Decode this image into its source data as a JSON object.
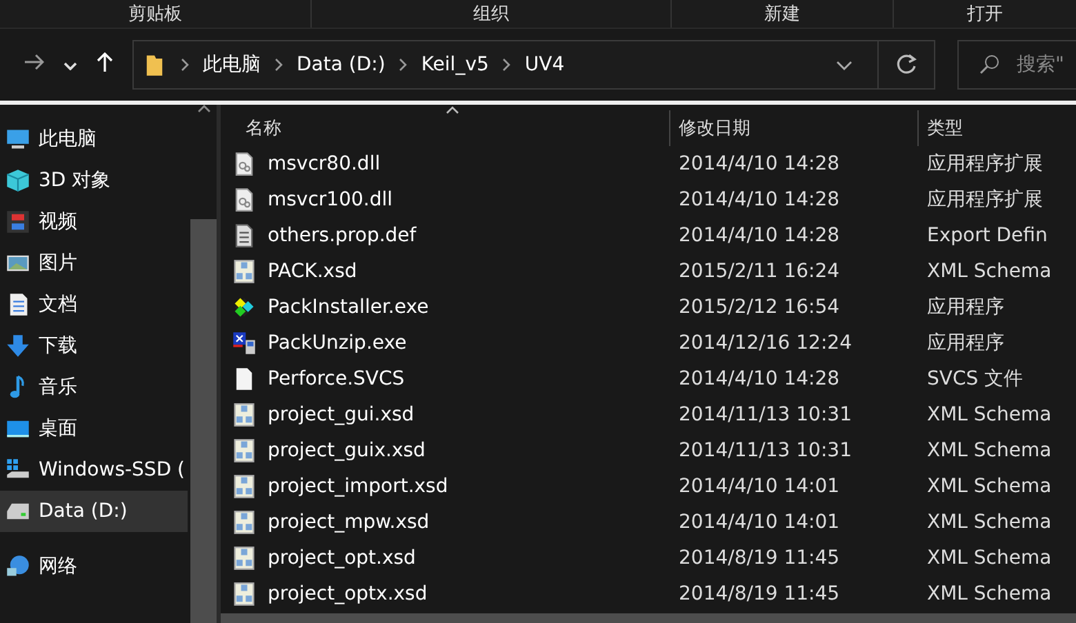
{
  "ribbon_groups": [
    "剪贴板",
    "组织",
    "新建",
    "打开"
  ],
  "address_bar": {
    "path": [
      "此电脑",
      "Data (D:)",
      "Keil_v5",
      "UV4"
    ]
  },
  "search": {
    "placeholder": "搜索\""
  },
  "sidebar": {
    "items": [
      {
        "label": "此电脑",
        "kind": "pc",
        "selected": false
      },
      {
        "label": "3D 对象",
        "kind": "cube",
        "selected": false
      },
      {
        "label": "视频",
        "kind": "video",
        "selected": false
      },
      {
        "label": "图片",
        "kind": "picture",
        "selected": false
      },
      {
        "label": "文档",
        "kind": "document",
        "selected": false
      },
      {
        "label": "下载",
        "kind": "download",
        "selected": false
      },
      {
        "label": "音乐",
        "kind": "music",
        "selected": false
      },
      {
        "label": "桌面",
        "kind": "desktop",
        "selected": false
      },
      {
        "label": "Windows-SSD (",
        "kind": "drive-windows",
        "selected": false
      },
      {
        "label": "Data (D:)",
        "kind": "drive",
        "selected": true
      },
      {
        "label": "网络",
        "kind": "network",
        "selected": false
      }
    ]
  },
  "table": {
    "columns": [
      {
        "label": "名称",
        "sorted": true
      },
      {
        "label": "修改日期",
        "sorted": false
      },
      {
        "label": "类型",
        "sorted": false
      }
    ],
    "rows": [
      {
        "name": "msvcr80.dll",
        "date": "2014/4/10 14:28",
        "type": "应用程序扩展",
        "kind": "dll"
      },
      {
        "name": "msvcr100.dll",
        "date": "2014/4/10 14:28",
        "type": "应用程序扩展",
        "kind": "dll"
      },
      {
        "name": "others.prop.def",
        "date": "2014/4/10 14:28",
        "type": "Export Defin",
        "kind": "text"
      },
      {
        "name": "PACK.xsd",
        "date": "2015/2/11 16:24",
        "type": "XML Schema",
        "kind": "xsd"
      },
      {
        "name": "PackInstaller.exe",
        "date": "2015/2/12 16:54",
        "type": "应用程序",
        "kind": "installer"
      },
      {
        "name": "PackUnzip.exe",
        "date": "2014/12/16 12:24",
        "type": "应用程序",
        "kind": "unzip"
      },
      {
        "name": "Perforce.SVCS",
        "date": "2014/4/10 14:28",
        "type": "SVCS 文件",
        "kind": "blank"
      },
      {
        "name": "project_gui.xsd",
        "date": "2014/11/13 10:31",
        "type": "XML Schema",
        "kind": "xsd"
      },
      {
        "name": "project_guix.xsd",
        "date": "2014/11/13 10:31",
        "type": "XML Schema",
        "kind": "xsd"
      },
      {
        "name": "project_import.xsd",
        "date": "2014/4/10 14:01",
        "type": "XML Schema",
        "kind": "xsd"
      },
      {
        "name": "project_mpw.xsd",
        "date": "2014/4/10 14:01",
        "type": "XML Schema",
        "kind": "xsd"
      },
      {
        "name": "project_opt.xsd",
        "date": "2014/8/19 11:45",
        "type": "XML Schema",
        "kind": "xsd"
      },
      {
        "name": "project_optx.xsd",
        "date": "2014/8/19 11:45",
        "type": "XML Schema",
        "kind": "xsd"
      }
    ]
  }
}
